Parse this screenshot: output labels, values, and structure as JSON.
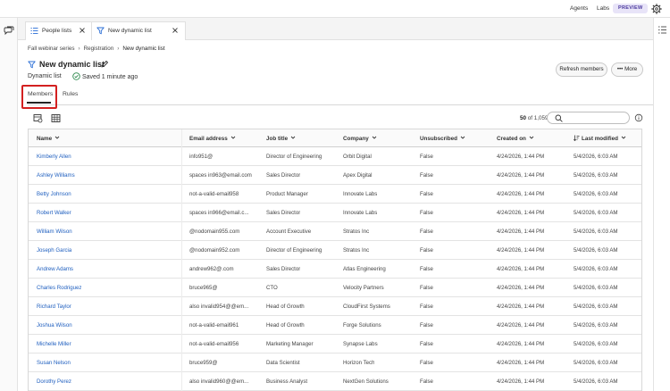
{
  "topbar": {
    "agents": "Agents",
    "labs": "Labs",
    "preview": "PREVIEW"
  },
  "tabs": [
    {
      "label": "People lists",
      "icon": "list-icon"
    },
    {
      "label": "New dynamic list",
      "icon": "filter-icon"
    }
  ],
  "breadcrumb": {
    "items": [
      "Fall webinar series",
      "Registration"
    ],
    "current": "New dynamic list"
  },
  "header": {
    "title": "New dynamic list",
    "type": "Dynamic list",
    "saved": "Saved 1 minute ago",
    "refresh_label": "Refresh members",
    "more_label": "More"
  },
  "page_tabs": {
    "members": "Members",
    "rules": "Rules"
  },
  "toolbar": {
    "count_shown": "50",
    "count_total": "of 1,059"
  },
  "table": {
    "columns": [
      "Name",
      "Email address",
      "Job title",
      "Company",
      "Unsubscribed",
      "Created on",
      "Last modified"
    ],
    "rows": [
      [
        "Kimberly Allen",
        "info951@",
        "Director of Engineering",
        "Orbit Digital",
        "False",
        "4/24/2026, 1:44 PM",
        "5/4/2026, 6:03 AM"
      ],
      [
        "Ashley Williams",
        "spaces in963@email.com",
        "Sales Director",
        "Apex Digital",
        "False",
        "4/24/2026, 1:44 PM",
        "5/4/2026, 6:03 AM"
      ],
      [
        "Betty Johnson",
        "not-a-valid-email958",
        "Product Manager",
        "Innovate Labs",
        "False",
        "4/24/2026, 1:44 PM",
        "5/4/2026, 6:03 AM"
      ],
      [
        "Robert Walker",
        "spaces in966@email.c...",
        "Sales Director",
        "Innovate Labs",
        "False",
        "4/24/2026, 1:44 PM",
        "5/4/2026, 6:03 AM"
      ],
      [
        "William Wilson",
        "@nodomain955.com",
        "Account Executive",
        "Stratos Inc",
        "False",
        "4/24/2026, 1:44 PM",
        "5/4/2026, 6:03 AM"
      ],
      [
        "Joseph Garcia",
        "@nodomain952.com",
        "Director of Engineering",
        "Stratos Inc",
        "False",
        "4/24/2026, 1:44 PM",
        "5/4/2026, 6:03 AM"
      ],
      [
        "Andrew Adams",
        "andrew962@.com",
        "Sales Director",
        "Atlas Engineering",
        "False",
        "4/24/2026, 1:44 PM",
        "5/4/2026, 6:03 AM"
      ],
      [
        "Charles Rodriguez",
        "bruce965@",
        "CTO",
        "Velocity Partners",
        "False",
        "4/24/2026, 1:44 PM",
        "5/4/2026, 6:03 AM"
      ],
      [
        "Richard Taylor",
        "also invalid954@@em...",
        "Head of Growth",
        "CloudFirst Systems",
        "False",
        "4/24/2026, 1:44 PM",
        "5/4/2026, 6:03 AM"
      ],
      [
        "Joshua Wilson",
        "not-a-valid-email961",
        "Head of Growth",
        "Forge Solutions",
        "False",
        "4/24/2026, 1:44 PM",
        "5/4/2026, 6:03 AM"
      ],
      [
        "Michelle Miller",
        "not-a-valid-email956",
        "Marketing Manager",
        "Synapse Labs",
        "False",
        "4/24/2026, 1:44 PM",
        "5/4/2026, 6:03 AM"
      ],
      [
        "Susan Nelson",
        "bruce959@",
        "Data Scientist",
        "Horizon Tech",
        "False",
        "4/24/2026, 1:44 PM",
        "5/4/2026, 6:03 AM"
      ],
      [
        "Dorothy Perez",
        "also invalid960@@em...",
        "Business Analyst",
        "NextGen Solutions",
        "False",
        "4/24/2026, 1:44 PM",
        "5/4/2026, 6:03 AM"
      ],
      [
        "",
        "",
        "",
        "",
        "",
        "",
        ""
      ]
    ]
  },
  "colors": {
    "link": "#1f5fbf",
    "highlight": "#d32020",
    "preview_bg": "#e8e4f8"
  }
}
